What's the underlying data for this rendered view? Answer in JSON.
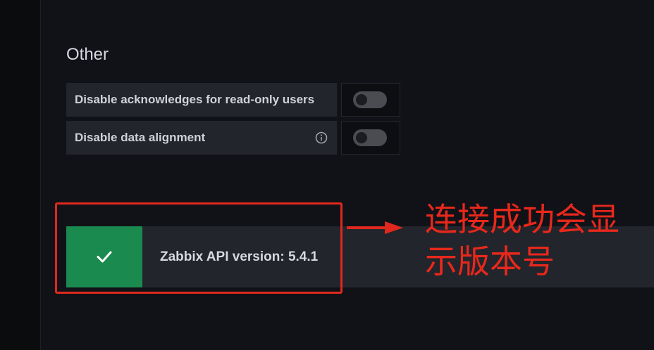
{
  "section": {
    "title": "Other"
  },
  "settings": [
    {
      "label": "Disable acknowledges for read-only users",
      "enabled": false,
      "has_info": false
    },
    {
      "label": "Disable data alignment",
      "enabled": false,
      "has_info": true
    }
  ],
  "alert": {
    "status": "success",
    "message": "Zabbix API version: 5.4.1",
    "icon": "check-icon"
  },
  "annotation": {
    "line1": "连接成功会显",
    "line2": "示版本号"
  },
  "colors": {
    "background": "#111217",
    "panel": "#22252b",
    "success": "#1b8a4f",
    "annotation": "#e0281e"
  }
}
